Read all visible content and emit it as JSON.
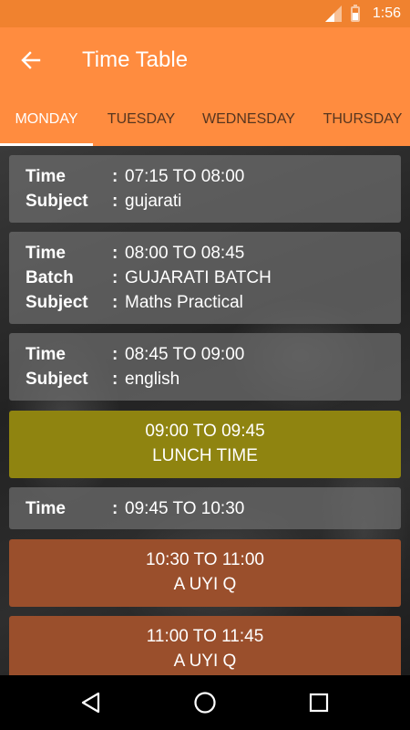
{
  "status_bar": {
    "time": "1:56"
  },
  "app_bar": {
    "title": "Time Table"
  },
  "tabs": [
    {
      "label": "MONDAY",
      "active": true
    },
    {
      "label": "TUESDAY",
      "active": false
    },
    {
      "label": "WEDNESDAY",
      "active": false
    },
    {
      "label": "THURSDAY",
      "active": false
    }
  ],
  "separator": ":",
  "entries": [
    {
      "style": "gray",
      "rows": [
        {
          "label": "Time",
          "value": "07:15 TO 08:00"
        },
        {
          "label": "Subject",
          "value": "gujarati"
        }
      ]
    },
    {
      "style": "gray",
      "rows": [
        {
          "label": "Time",
          "value": "08:00 TO 08:45"
        },
        {
          "label": "Batch",
          "value": "GUJARATI BATCH"
        },
        {
          "label": "Subject",
          "value": "Maths Practical"
        }
      ]
    },
    {
      "style": "gray",
      "rows": [
        {
          "label": "Time",
          "value": "08:45 TO 09:00"
        },
        {
          "label": "Subject",
          "value": "english"
        }
      ]
    },
    {
      "style": "yellow",
      "lines": [
        "09:00 TO 09:45",
        "LUNCH TIME"
      ]
    },
    {
      "style": "gray",
      "rows": [
        {
          "label": "Time",
          "value": "09:45 TO 10:30"
        }
      ]
    },
    {
      "style": "brown",
      "lines": [
        "10:30 TO 11:00",
        "A UYI Q"
      ]
    },
    {
      "style": "brown",
      "lines": [
        "11:00 TO 11:45",
        "A UYI Q"
      ]
    }
  ],
  "colors": {
    "primary": "#ff8c3f",
    "status_bar": "#f0822f",
    "lunch": "#8f8410",
    "break": "#9a4f2c"
  },
  "icons": {
    "back": "arrow-left-icon",
    "nav": [
      "back-triangle-icon",
      "home-circle-icon",
      "recents-square-icon"
    ]
  }
}
